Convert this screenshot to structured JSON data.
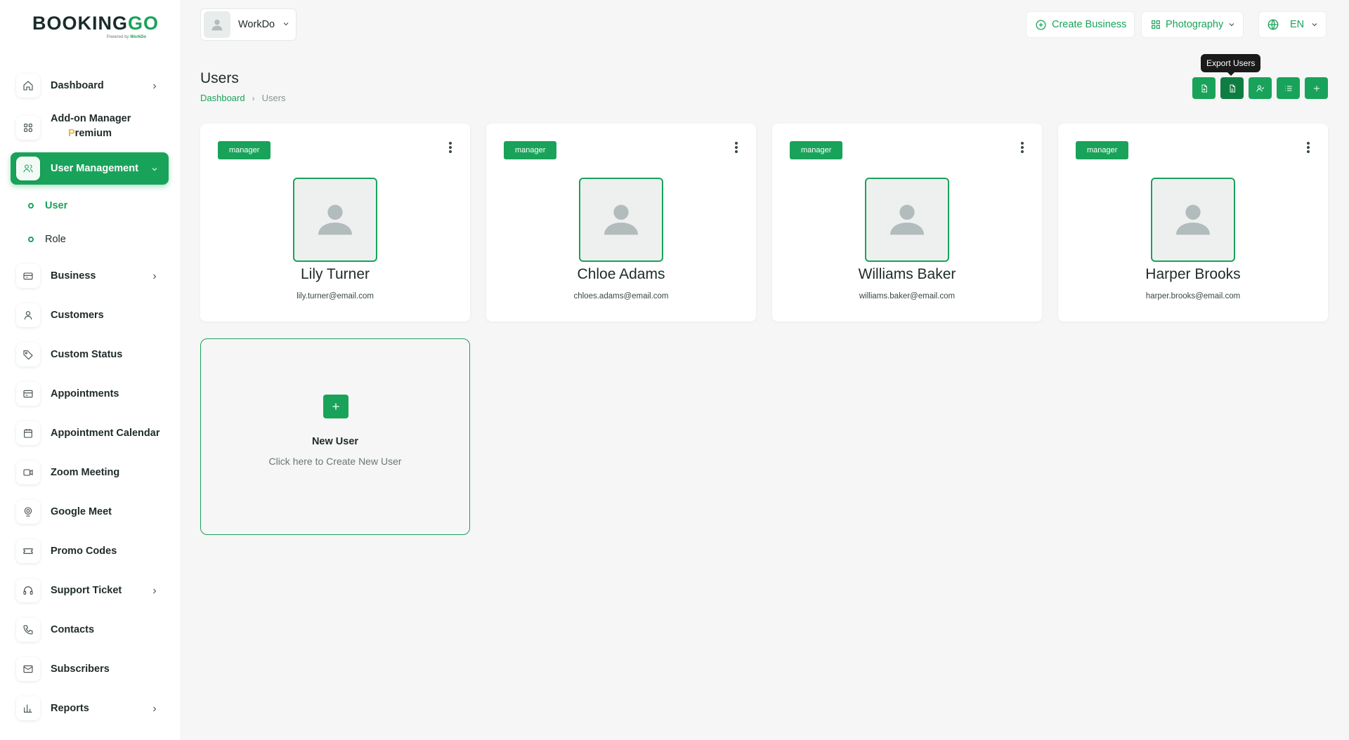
{
  "brand": {
    "name_prefix": "BOOKING",
    "name_suffix": "GO",
    "tagline_prefix": "Powered by",
    "tagline_brand": "WorkDo"
  },
  "workspace": {
    "name": "WorkDo"
  },
  "topbar": {
    "create_business": "Create Business",
    "category": "Photography",
    "language": "EN"
  },
  "sidebar": {
    "items": [
      {
        "label": "Dashboard",
        "icon": "home-icon"
      },
      {
        "label": "Add-on Manager",
        "icon": "grid-icon"
      },
      {
        "label": "User Management",
        "icon": "users-icon"
      },
      {
        "label": "Business",
        "icon": "building-icon"
      },
      {
        "label": "Customers",
        "icon": "user-icon"
      },
      {
        "label": "Custom Status",
        "icon": "tag-icon"
      },
      {
        "label": "Appointments",
        "icon": "card-icon"
      },
      {
        "label": "Appointment Calendar",
        "icon": "calendar-icon"
      },
      {
        "label": "Zoom Meeting",
        "icon": "video-icon"
      },
      {
        "label": "Google Meet",
        "icon": "webcam-icon"
      },
      {
        "label": "Promo Codes",
        "icon": "ticket-icon"
      },
      {
        "label": "Support Ticket",
        "icon": "headset-icon"
      },
      {
        "label": "Contacts",
        "icon": "phone-icon"
      },
      {
        "label": "Subscribers",
        "icon": "mail-icon"
      },
      {
        "label": "Reports",
        "icon": "chart-icon"
      }
    ],
    "addon_badge_first": "P",
    "addon_badge_rest": "remium",
    "subitems": [
      {
        "label": "User"
      },
      {
        "label": "Role"
      }
    ]
  },
  "page": {
    "title": "Users"
  },
  "breadcrumb": {
    "home": "Dashboard",
    "current": "Users"
  },
  "actions": {
    "tooltip": "Export Users"
  },
  "users": [
    {
      "role": "manager",
      "name": "Lily Turner",
      "email": "lily.turner@email.com"
    },
    {
      "role": "manager",
      "name": "Chloe Adams",
      "email": "chloes.adams@email.com"
    },
    {
      "role": "manager",
      "name": "Williams Baker",
      "email": "williams.baker@email.com"
    },
    {
      "role": "manager",
      "name": "Harper Brooks",
      "email": "harper.brooks@email.com"
    }
  ],
  "new_user": {
    "title": "New User",
    "subtitle": "Click here to Create New User"
  },
  "colors": {
    "accent": "#19a35a",
    "accent_dark": "#0f7d42",
    "premium": "#e8b93a"
  }
}
